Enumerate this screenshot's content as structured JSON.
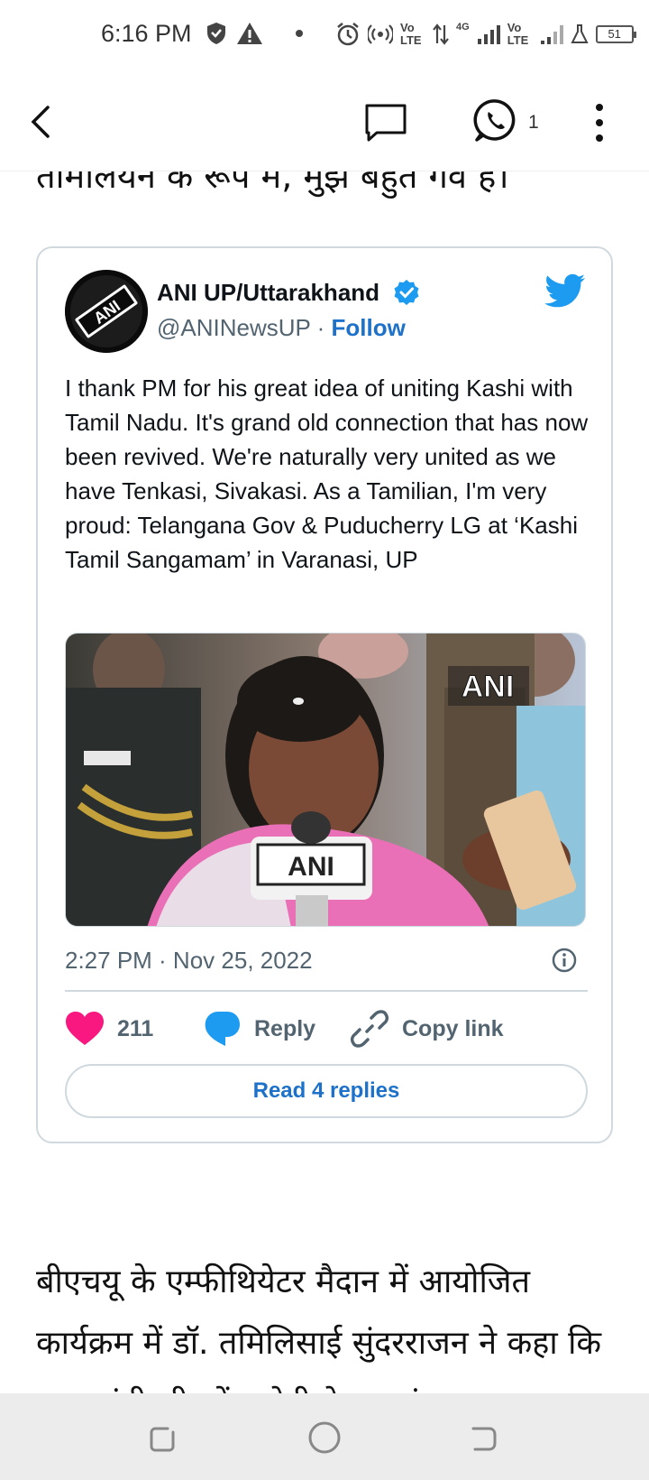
{
  "status_bar": {
    "time": "6:16 PM",
    "battery": "51",
    "network_labels": [
      "Vo LTE",
      "4G",
      "Vo LTE"
    ]
  },
  "app_bar": {
    "whatsapp_count": "1",
    "icons": [
      "back-arrow-icon",
      "comment-icon",
      "whatsapp-icon",
      "more-vertical-icon"
    ]
  },
  "article": {
    "partial_heading": "तामालयन क रूप म, मुझ बहुत गव ह।",
    "paragraph": "बीएचयू के एम्फीथियेटर मैदान में आयोजित कार्यक्रम में डॉ. तमिलिसाई सुंदरराजन ने कहा कि प्रधानमंत्री श्री नरेंद्र मोदी ने इस संगम का"
  },
  "tweet": {
    "author_name": "ANI UP/Uttarakhand",
    "handle": "@ANINewsUP",
    "separator": "·",
    "follow_label": "Follow",
    "text": "I thank PM for his great idea of uniting Kashi with Tamil Nadu. It's grand old connection that has now been revived. We're naturally very united as we have Tenkasi, Sivakasi. As a Tamilian, I'm very proud: Telangana Gov & Puducherry LG at  ‘Kashi Tamil Sangamam’ in Varanasi, UP",
    "photo_watermark": "ANI",
    "mic_label": "ANI",
    "avatar_label": "ANI",
    "timestamp": "2:27 PM · Nov 25, 2022",
    "like_count": "211",
    "reply_label": "Reply",
    "copy_link_label": "Copy link",
    "read_replies_label": "Read 4 replies"
  },
  "colors": {
    "link_blue": "#1d71c9",
    "twitter_blue": "#1d9bf0",
    "like_pink": "#f91880",
    "muted_gray": "#536471",
    "border": "#cfd9de"
  }
}
